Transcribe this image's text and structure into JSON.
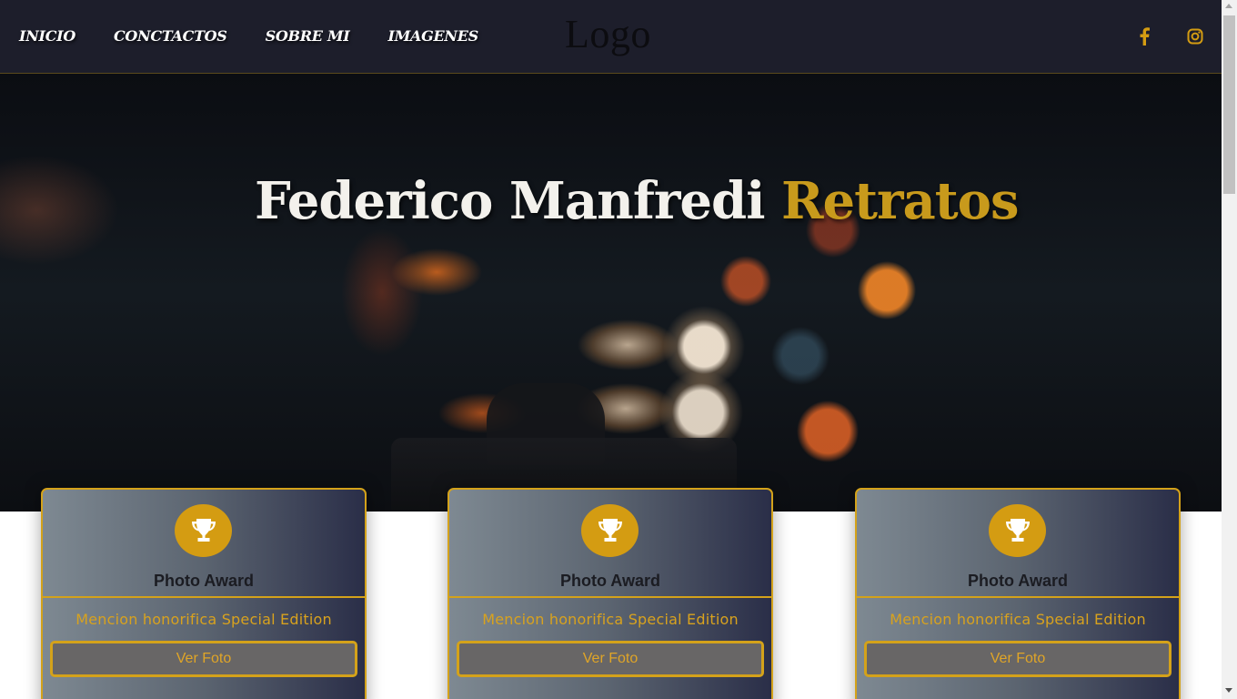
{
  "nav": {
    "links": [
      "INICIO",
      "CONCTACTOS",
      "SOBRE MI",
      "IMAGENES"
    ],
    "logo": "Logo",
    "social": [
      {
        "icon": "facebook-icon"
      },
      {
        "icon": "instagram-icon"
      }
    ]
  },
  "hero": {
    "title_name": "Federico Manfredi",
    "title_accent": "Retratos"
  },
  "cards": [
    {
      "icon": "trophy-icon",
      "title": "Photo Award",
      "subtitle": "Mencion honorifica Special Edition",
      "button": "Ver Foto"
    },
    {
      "icon": "trophy-icon",
      "title": "Photo Award",
      "subtitle": "Mencion honorifica Special Edition",
      "button": "Ver Foto"
    },
    {
      "icon": "trophy-icon",
      "title": "Photo Award",
      "subtitle": "Mencion honorifica Special Edition",
      "button": "Ver Foto"
    }
  ],
  "colors": {
    "accent": "#d4a21a",
    "navbar": "#1d1e2b",
    "hero_title": "#f3f1ec",
    "button_bg": "#686666"
  }
}
